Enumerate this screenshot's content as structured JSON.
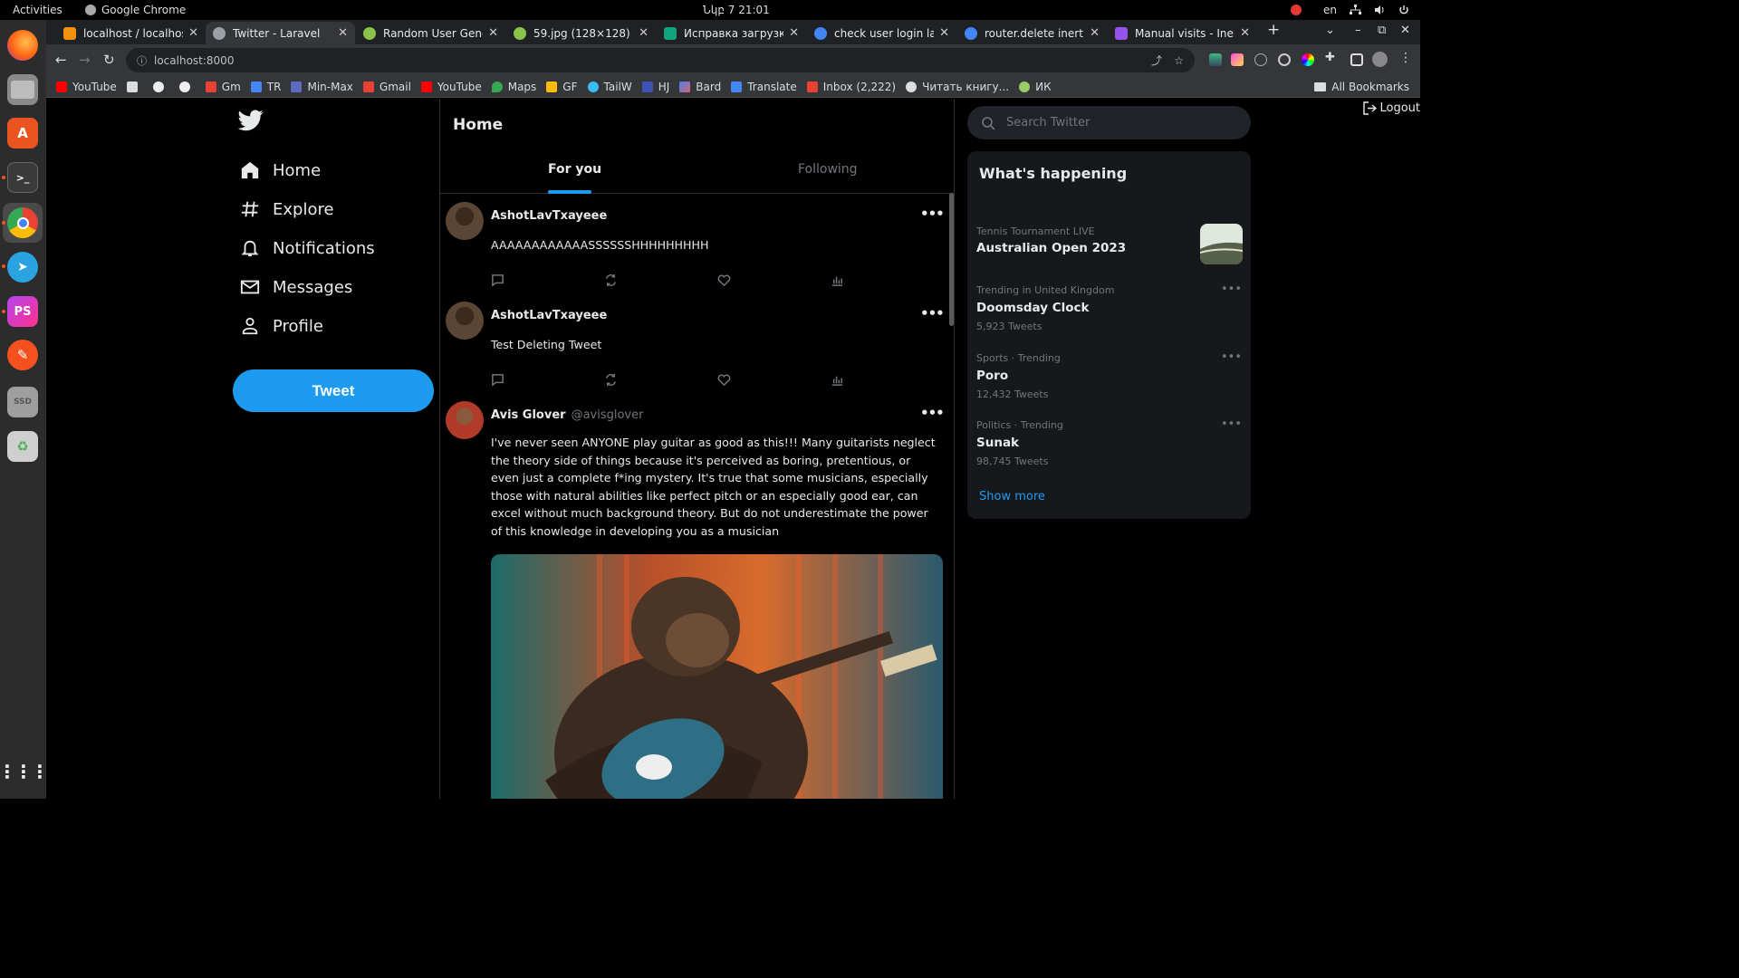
{
  "os": {
    "activities": "Activities",
    "app_name": "Google Chrome",
    "clock": "Նկբ 7  21:01",
    "lang": "en"
  },
  "browser": {
    "tabs": [
      {
        "title": "localhost / localhost",
        "color": "#f29111"
      },
      {
        "title": "Twitter - Laravel",
        "color": "#9aa0a6"
      },
      {
        "title": "Random User Generator",
        "color": "#8bc34a"
      },
      {
        "title": "59.jpg (128×128)",
        "color": "#8bc34a"
      },
      {
        "title": "Исправка загрузки",
        "color": "#10a37f"
      },
      {
        "title": "check user login laravel",
        "color": "#4285f4"
      },
      {
        "title": "router.delete inertia",
        "color": "#4285f4"
      },
      {
        "title": "Manual visits - Inertia",
        "color": "#9553e9"
      }
    ],
    "url": "localhost:8000",
    "bookmarks": [
      "YouTube",
      "",
      "",
      "",
      "Gm",
      "TR",
      "Min-Max",
      "Gmail",
      "YouTube",
      "Maps",
      "GF",
      "TailW",
      "HJ",
      "Bard",
      "Translate",
      "Inbox (2,222)",
      "Читать книгу...",
      "ИК"
    ],
    "all_bookmarks": "All Bookmarks"
  },
  "page": {
    "logout": "Logout",
    "nav": [
      "Home",
      "Explore",
      "Notifications",
      "Messages",
      "Profile"
    ],
    "tweet_button": "Tweet",
    "home_title": "Home",
    "tabs": {
      "for_you": "For you",
      "following": "Following"
    },
    "tweets": [
      {
        "name": "AshotLavTxayeee",
        "handle": "",
        "text": "AAAAAAAAAAAASSSSSSHHHHHHHHH"
      },
      {
        "name": "AshotLavTxayeee",
        "handle": "",
        "text": "Test Deleting Tweet"
      },
      {
        "name": "Avis Glover",
        "handle": "@avisglover",
        "text": "I've never seen ANYONE play guitar as good as this!!! Many guitarists neglect the theory side of things because it's perceived as boring, pretentious, or even just a complete f*ing mystery. It's true that some musicians, especially those with natural abilities like perfect pitch or an especially good ear, can excel without much background theory. But do not underestimate the power of this knowledge in developing you as a musician"
      }
    ],
    "search_placeholder": "Search Twitter",
    "trends_title": "What's happening",
    "trends": [
      {
        "meta": "Tennis Tournament LIVE",
        "title": "Australian Open 2023",
        "count": ""
      },
      {
        "meta": "Trending in United Kingdom",
        "title": "Doomsday Clock",
        "count": "5,923 Tweets"
      },
      {
        "meta": "Sports · Trending",
        "title": "Poro",
        "count": "12,432 Tweets"
      },
      {
        "meta": "Politics · Trending",
        "title": "Sunak",
        "count": "98,745 Tweets"
      }
    ],
    "show_more": "Show more"
  },
  "colors": {
    "accent": "#1d9bf0",
    "background": "#000000",
    "card": "#16181c"
  }
}
